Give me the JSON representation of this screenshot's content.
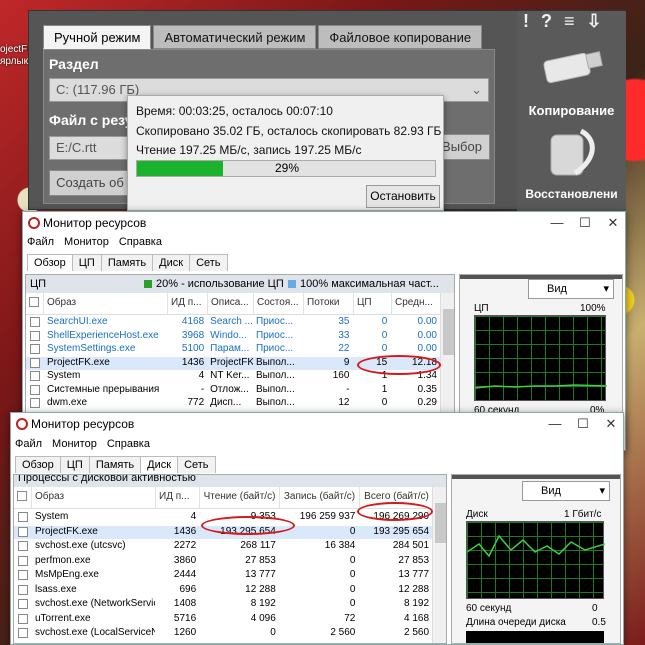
{
  "desktop": {
    "icon1": "ojectFK",
    "icon2": "ярлык"
  },
  "copy_app": {
    "tabs": [
      "Ручной режим",
      "Автоматический режим",
      "Файловое копирование"
    ],
    "top_glyphs": [
      "!",
      "?",
      "≡",
      "⇩"
    ],
    "partition_label": "Раздел",
    "partition_value": "C: (117.96 ГБ)",
    "file_label": "Файл с резул",
    "file_value": "E:/C.rtt",
    "browse_button": "Выбор",
    "create_button": "Создать об",
    "copy_label": "Копирование",
    "restore_label": "Восстановлени"
  },
  "progress": {
    "time_line": "Время: 00:03:25, осталось 00:07:10",
    "copied_line": "Скопировано 35.02 ГБ, осталось скопировать 82.93 ГБ",
    "speed_line": "Чтение 197.25 МБ/с, запись 197.25 МБ/с",
    "percent_label": "29%",
    "percent_value": 29,
    "stop_button": "Остановить"
  },
  "rm_cpu": {
    "title": "Монитор ресурсов",
    "menu": [
      "Файл",
      "Монитор",
      "Справка"
    ],
    "tabs": [
      "Обзор",
      "ЦП",
      "Память",
      "Диск",
      "Сеть"
    ],
    "section": "ЦП",
    "usage": "20% - использование ЦП",
    "maxfreq": "100% максимальная част...",
    "columns": [
      "Образ",
      "ИД п...",
      "Описа...",
      "Состоя...",
      "Потоки",
      "ЦП",
      "Средн..."
    ],
    "rows": [
      {
        "name": "SearchUI.exe",
        "pid": "4168",
        "desc": "Search ...",
        "state": "Приос...",
        "threads": "35",
        "cpu": "0",
        "avg": "0.00",
        "blue": true
      },
      {
        "name": "ShellExperienceHost.exe",
        "pid": "3968",
        "desc": "Windo...",
        "state": "Приос...",
        "threads": "33",
        "cpu": "0",
        "avg": "0.00",
        "blue": true
      },
      {
        "name": "SystemSettings.exe",
        "pid": "5100",
        "desc": "Парам...",
        "state": "Приос...",
        "threads": "22",
        "cpu": "0",
        "avg": "0.00",
        "blue": true
      },
      {
        "name": "ProjectFK.exe",
        "pid": "1436",
        "desc": "ProjectFK",
        "state": "Выпол...",
        "threads": "9",
        "cpu": "15",
        "avg": "12.18",
        "blue": false
      },
      {
        "name": "System",
        "pid": "4",
        "desc": "NT Ker...",
        "state": "Выпол...",
        "threads": "160",
        "cpu": "1",
        "avg": "1.34",
        "blue": false
      },
      {
        "name": "Системные прерывания",
        "pid": "-",
        "desc": "Отлож...",
        "state": "Выпол...",
        "threads": "-",
        "cpu": "1",
        "avg": "0.35",
        "blue": false
      },
      {
        "name": "dwm.exe",
        "pid": "772",
        "desc": "Дисп...",
        "state": "Выпол...",
        "threads": "12",
        "cpu": "0",
        "avg": "0.29",
        "blue": false
      }
    ],
    "view_button": "Вид",
    "graph_title": "ЦП",
    "graph_max": "100%",
    "graph_time": "60 секунд",
    "graph_min": "0%"
  },
  "rm_disk": {
    "title": "Монитор ресурсов",
    "menu": [
      "Файл",
      "Монитор",
      "Справка"
    ],
    "tabs": [
      "Обзор",
      "ЦП",
      "Память",
      "Диск",
      "Сеть"
    ],
    "section": "Процессы с дисковой активностью",
    "columns": [
      "Образ",
      "ИД п...",
      "Чтение (байт/с)",
      "Запись (байт/с)",
      "Всего (байт/с)"
    ],
    "rows": [
      {
        "name": "System",
        "pid": "4",
        "read": "9 353",
        "write": "196 259 937",
        "total": "196 269 290"
      },
      {
        "name": "ProjectFK.exe",
        "pid": "1436",
        "read": "193 295 654",
        "write": "0",
        "total": "193 295 654"
      },
      {
        "name": "svchost.exe (utcsvc)",
        "pid": "2272",
        "read": "268 117",
        "write": "16 384",
        "total": "284 501"
      },
      {
        "name": "perfmon.exe",
        "pid": "3860",
        "read": "27 853",
        "write": "0",
        "total": "27 853"
      },
      {
        "name": "MsMpEng.exe",
        "pid": "2444",
        "read": "13 777",
        "write": "0",
        "total": "13 777"
      },
      {
        "name": "lsass.exe",
        "pid": "696",
        "read": "12 288",
        "write": "0",
        "total": "12 288"
      },
      {
        "name": "svchost.exe (NetworkService)",
        "pid": "1408",
        "read": "8 192",
        "write": "0",
        "total": "8 192"
      },
      {
        "name": "uTorrent.exe",
        "pid": "5716",
        "read": "4 096",
        "write": "72",
        "total": "4 168"
      },
      {
        "name": "svchost.exe (LocalServiceNet...",
        "pid": "1260",
        "read": "0",
        "write": "2 560",
        "total": "2 560"
      }
    ],
    "view_button": "Вид",
    "graph_title": "Диск",
    "graph_max": "1 Гбит/с",
    "graph_time": "60 секунд",
    "graph_min": "0",
    "queue_label": "Длина очереди диска",
    "queue_value": "0.5"
  }
}
